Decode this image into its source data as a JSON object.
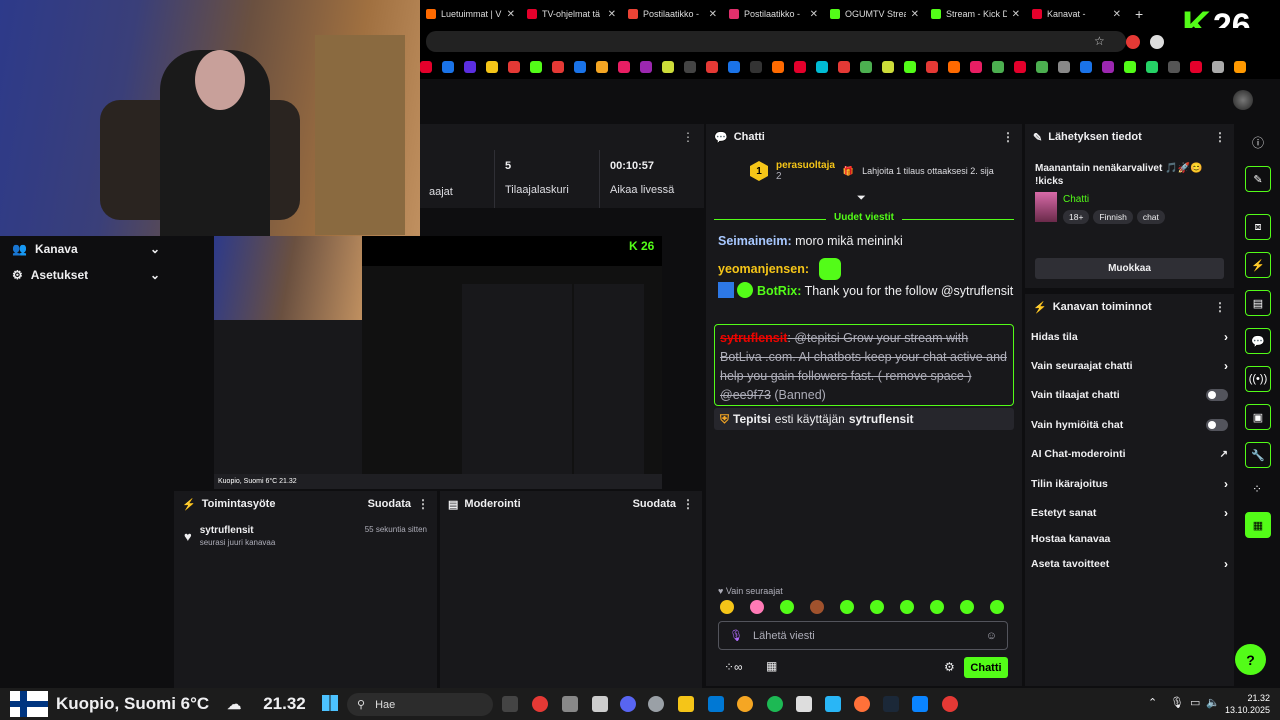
{
  "browser": {
    "tabs": [
      {
        "label": "Luetuimmat | V",
        "color": "#ff6a00"
      },
      {
        "label": "TV-ohjelmat tä",
        "color": "#e4002b"
      },
      {
        "label": "Postilaatikko -",
        "color": "#ea4335"
      },
      {
        "label": "Postilaatikko -",
        "color": "#e1306c"
      },
      {
        "label": "OGUMTV Strea",
        "color": "#53fc18"
      },
      {
        "label": "Stream - Kick D",
        "color": "#53fc18"
      },
      {
        "label": "Kanavat - ",
        "color": "#e4002b"
      }
    ],
    "new_tab": "+",
    "brand_k": "K",
    "brand_number": "26"
  },
  "sidebar": {
    "items": [
      {
        "label": "Kanava",
        "icon": "users-icon"
      },
      {
        "label": "Asetukset",
        "icon": "gear-icon"
      }
    ]
  },
  "stats": {
    "items": [
      {
        "value": "",
        "label": "aajat"
      },
      {
        "value": "5",
        "label": "Tilaajalaskuri"
      },
      {
        "value": "00:10:57",
        "label": "Aikaa livessä"
      }
    ]
  },
  "activity": {
    "title": "Toimintasyöte",
    "filter": "Suodata",
    "items": [
      {
        "name": "sytruflensit",
        "sub": "seurasi juuri kanavaa",
        "time": "55 sekuntia sitten"
      }
    ]
  },
  "moderation": {
    "title": "Moderointi",
    "filter": "Suodata"
  },
  "chat": {
    "title": "Chatti",
    "leader": {
      "rank": "1",
      "name": "perasuoltaja",
      "count": "2",
      "note": "Lahjoita 1 tilaus ottaaksesi 2. sija"
    },
    "new_messages": "Uudet viestit",
    "messages": [
      {
        "user": "Seimaineim:",
        "text": " moro mikä meininki",
        "color": "#a8c8ff"
      },
      {
        "user": "yeomanjensen:",
        "text": "",
        "color": "#f5c518"
      },
      {
        "user": "BotRix:",
        "text": " Thank you for the follow @sytruflensit",
        "color": "#53fc18"
      }
    ],
    "banned": {
      "user": "sytruflensit",
      "text": ": @tepitsi Grow your stream with BotLiva .com. AI chatbots keep your chat active and help you gain followers fast. ( remove space ) @ee9f73",
      "suffix": " (Banned)"
    },
    "mod_note": {
      "mod": "Tepitsi",
      "action": " esti käyttäjän ",
      "target": "sytruflensit"
    },
    "followers_only": "Vain seuraajat",
    "input_placeholder": "Lähetä viesti",
    "send_label": "Chatti"
  },
  "stream_info": {
    "title_header": "Lähetyksen tiedot",
    "stream_title": "Maanantain nenäkarvalivet 🎵🚀😊 !kicks",
    "category": "Chatti",
    "tags": [
      "18+",
      "Finnish",
      "chat"
    ],
    "edit_label": "Muokkaa"
  },
  "channel_actions": {
    "title": "Kanavan toiminnot",
    "items": [
      {
        "label": "Hidas tila",
        "kind": "chevron"
      },
      {
        "label": "Vain seuraajat chatti",
        "kind": "chevron"
      },
      {
        "label": "Vain tilaajat chatti",
        "kind": "toggle"
      },
      {
        "label": "Vain hymiöitä chat",
        "kind": "toggle"
      },
      {
        "label": "AI Chat-moderointi",
        "kind": "external"
      },
      {
        "label": "Tilin ikärajoitus",
        "kind": "chevron"
      },
      {
        "label": "Estetyt sanat",
        "kind": "chevron"
      },
      {
        "label": "Hostaa kanavaa",
        "kind": "none"
      },
      {
        "label": "Aseta tavoitteet",
        "kind": "chevron"
      }
    ]
  },
  "preview": {
    "caption": "Kuopio, Suomi 6°C   21.32",
    "k_badge": "K 26"
  },
  "taskbar": {
    "weather": "Kuopio, Suomi 6°C",
    "time_big": "21.32",
    "search_placeholder": "Hae",
    "clock_time": "21.32",
    "clock_date": "13.10.2025"
  },
  "colors": {
    "accent": "#53fc18",
    "panel": "#18181b",
    "bg": "#0e0e10",
    "banned": "#eb0400"
  }
}
